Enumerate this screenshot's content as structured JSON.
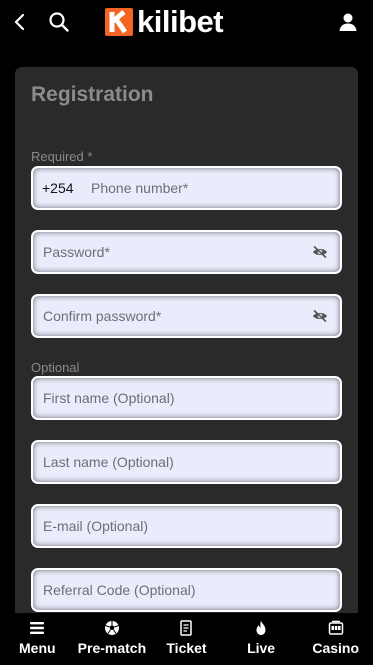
{
  "header": {
    "logo_text": "kilibet",
    "logo_color": "#f26522"
  },
  "form": {
    "title": "Registration",
    "required_label": "Required *",
    "optional_label": "Optional",
    "phone_prefix": "+254",
    "phone_placeholder": "Phone number*",
    "password_placeholder": "Password*",
    "confirm_password_placeholder": "Confirm password*",
    "first_name_placeholder": "First name (Optional)",
    "last_name_placeholder": "Last name (Optional)",
    "email_placeholder": "E-mail (Optional)",
    "referral_placeholder": "Referral Code (Optional)"
  },
  "nav": {
    "menu": "Menu",
    "prematch": "Pre-match",
    "ticket": "Ticket",
    "live": "Live",
    "casino": "Casino"
  }
}
